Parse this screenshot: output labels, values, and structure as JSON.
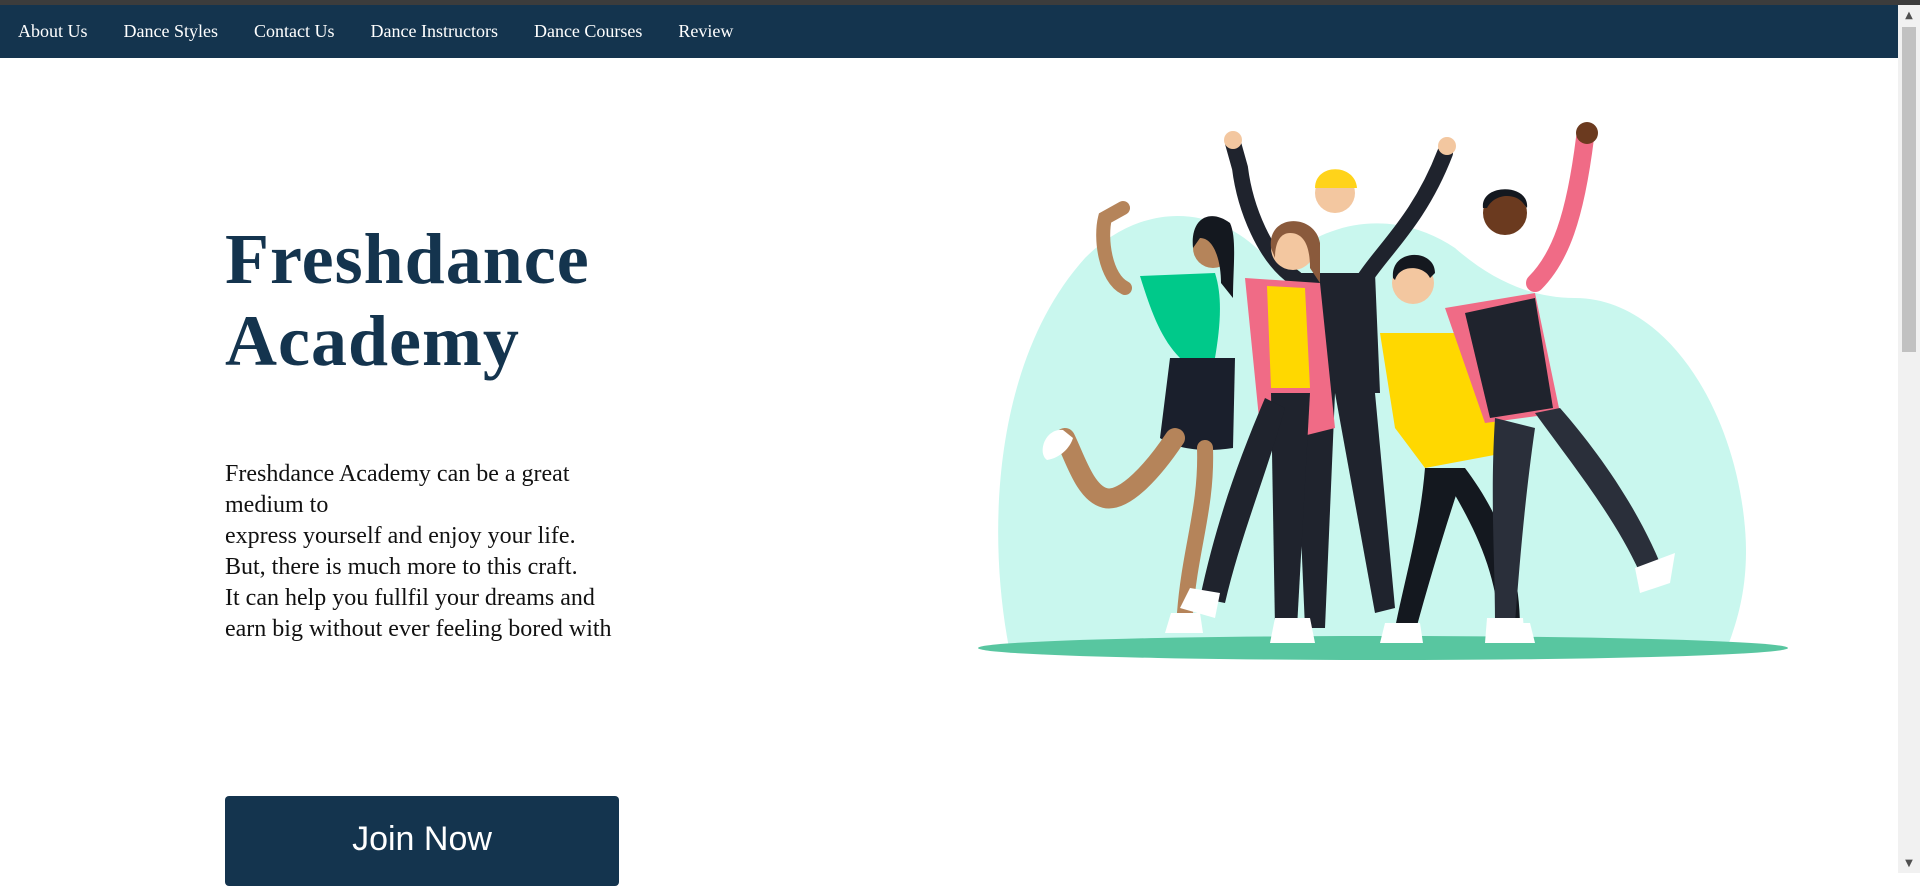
{
  "nav": {
    "items": [
      {
        "label": "About Us"
      },
      {
        "label": "Dance Styles"
      },
      {
        "label": "Contact Us"
      },
      {
        "label": "Dance Instructors"
      },
      {
        "label": "Dance Courses"
      },
      {
        "label": "Review"
      }
    ]
  },
  "hero": {
    "title_line1": "Freshdance",
    "title_line2": "Academy",
    "description_lines": [
      "Freshdance Academy can be a great medium to",
      "express yourself and enjoy your life.",
      "But, there is much more to this craft.",
      "It can help you fullfil your dreams and",
      "earn big without ever feeling bored with"
    ],
    "cta_label": "Join Now",
    "illustration": "group-of-dancers-illustration"
  },
  "colors": {
    "navbar": "#14344e",
    "title": "#14344e",
    "button": "#14344e",
    "illustration_bg": "#c9f7ee",
    "ground": "#58c6a0"
  },
  "icons": {
    "scroll_up": "scroll-up-arrow-icon",
    "scroll_down": "scroll-down-arrow-icon"
  }
}
